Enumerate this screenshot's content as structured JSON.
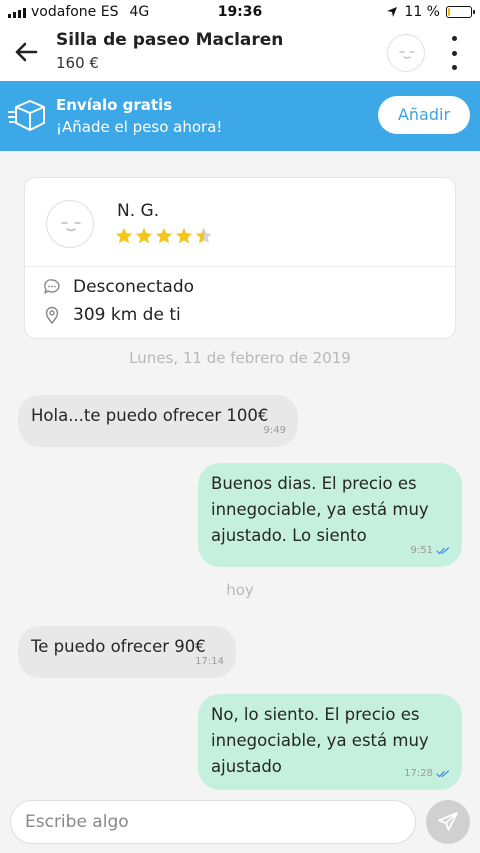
{
  "status_bar": {
    "carrier": "vodafone ES",
    "network": "4G",
    "time": "19:36",
    "battery": "11 %",
    "battery_level": 0.11
  },
  "header": {
    "title": "Silla de paseo Maclaren",
    "price": "160 €",
    "back_icon": "back-arrow-icon",
    "menu_icon": "more-vertical-icon"
  },
  "banner": {
    "title": "Envíalo gratis",
    "subtitle": "¡Añade el peso ahora!",
    "button": "Añadir",
    "color": "#3da8e8"
  },
  "profile": {
    "name": "N. G.",
    "rating": 4.5,
    "status": "Desconectado",
    "distance": "309 km de ti"
  },
  "chat": {
    "date1": "Lunes, 11 de febrero de 2019",
    "date2": "hoy",
    "messages": [
      {
        "direction": "in",
        "text": "Hola...te puedo ofrecer 100€",
        "time": "9:49"
      },
      {
        "direction": "out",
        "text": "Buenos dias. El precio es innegociable, ya está muy ajustado. Lo siento",
        "time": "9:51"
      },
      {
        "direction": "in",
        "text": "Te puedo ofrecer 90€",
        "time": "17:14"
      },
      {
        "direction": "out",
        "text": "No, lo siento. El precio es innegociable, ya está muy ajustado",
        "time": "17:28"
      }
    ]
  },
  "input": {
    "placeholder": "Escribe algo"
  },
  "colors": {
    "accent": "#3da8e8",
    "outgoing_bubble": "#c5f0de",
    "incoming_bubble": "#e8e8e8",
    "star": "#f5c518"
  }
}
